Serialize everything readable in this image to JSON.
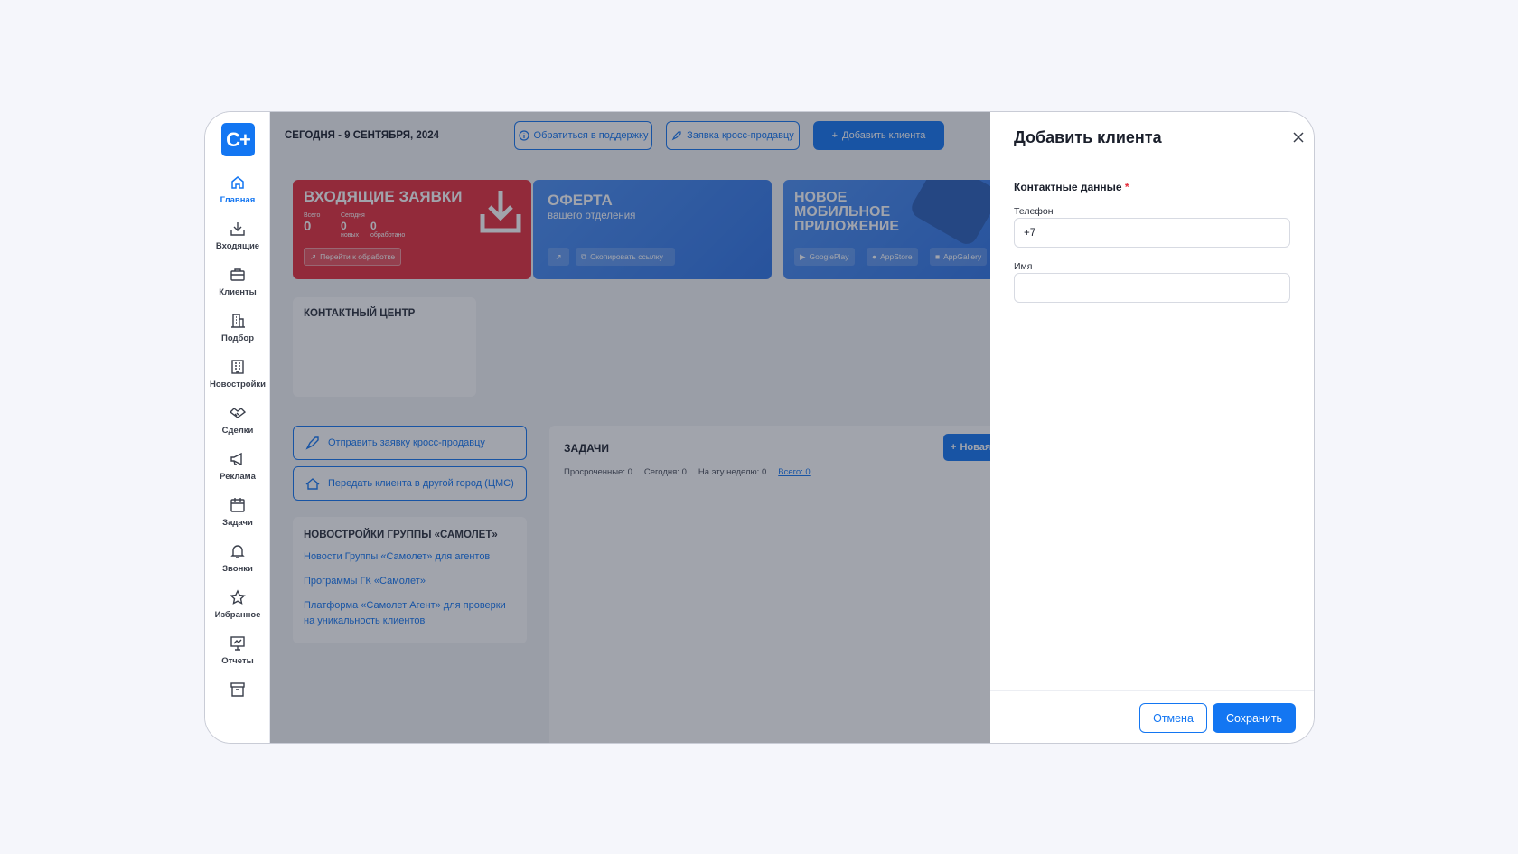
{
  "logo": "С+",
  "nav": [
    {
      "label": "Главная",
      "icon": "home-icon",
      "active": true
    },
    {
      "label": "Входящие",
      "icon": "inbox-icon"
    },
    {
      "label": "Клиенты",
      "icon": "briefcase-icon"
    },
    {
      "label": "Подбор",
      "icon": "building-icon"
    },
    {
      "label": "Новостройки",
      "icon": "office-building-icon"
    },
    {
      "label": "Сделки",
      "icon": "handshake-icon"
    },
    {
      "label": "Реклама",
      "icon": "megaphone-icon"
    },
    {
      "label": "Задачи",
      "icon": "calendar-icon"
    },
    {
      "label": "Звонки",
      "icon": "bell-icon"
    },
    {
      "label": "Избранное",
      "icon": "star-icon"
    },
    {
      "label": "Отчеты",
      "icon": "presentation-icon"
    },
    {
      "label": "",
      "icon": "archive-icon"
    }
  ],
  "header": {
    "date": "СЕГОДНЯ - 9 СЕНТЯБРЯ, 2024",
    "support": "Обратиться в поддержку",
    "cross_sell": "Заявка кросс-продавцу",
    "add_client": "Добавить клиента"
  },
  "incoming": {
    "title": "ВХОДЯЩИЕ ЗАЯВКИ",
    "total_label": "Всего",
    "total": "0",
    "today_label": "Сегодня",
    "new_value": "0",
    "new_label": "новых",
    "processed_value": "0",
    "processed_label": "обработано",
    "go": "Перейти к обработке"
  },
  "offer": {
    "title": "ОФЕРТА",
    "subtitle": "вашего отделения",
    "copy": "Скопировать ссылку"
  },
  "app": {
    "title_1": "НОВОЕ",
    "title_2": "МОБИЛЬНОЕ",
    "title_3": "ПРИЛОЖЕНИЕ",
    "gp": "GooglePlay",
    "as": "AppStore",
    "ag": "AppGallery"
  },
  "contact_center": {
    "title": "КОНТАКТНЫЙ ЦЕНТР"
  },
  "actions": {
    "send_cross": "Отправить заявку кросс-продавцу",
    "transfer": "Передать клиента в другой город (ЦМС)"
  },
  "group": {
    "title": "НОВОСТРОЙКИ ГРУППЫ «САМОЛЕТ»",
    "links": [
      "Новости Группы «Самолет» для агентов",
      "Программы ГК «Самолет»",
      "Платформа «Самолет Агент» для проверки на уникальность клиентов"
    ]
  },
  "tasks": {
    "title": "ЗАДАЧИ",
    "overdue": "Просроченные: 0",
    "today": "Сегодня: 0",
    "week": "На эту неделю: 0",
    "total": "Всего: 0",
    "new_button": "Новая"
  },
  "drawer": {
    "title": "Добавить клиента",
    "section": "Контактные данные",
    "required_mark": "*",
    "phone_label": "Телефон",
    "phone_value": "+7",
    "name_label": "Имя",
    "name_value": "",
    "cancel": "Отмена",
    "save": "Сохранить"
  },
  "colors": {
    "accent": "#1376f2",
    "incoming_card": "#e52d3b",
    "overlay": "#1f263a"
  }
}
